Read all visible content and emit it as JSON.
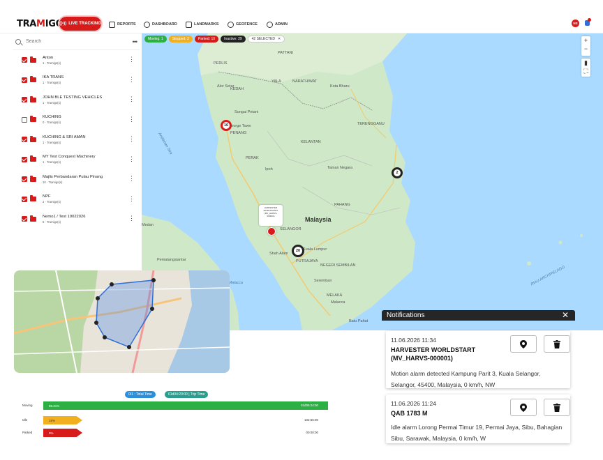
{
  "app": {
    "logo_text": "TRAMIGO",
    "live_tracking_label": "LIVE TRACKING",
    "nav": {
      "reports": "REPORTS",
      "dashboard": "DASHBOARD",
      "landmarks": "LANDMARKS",
      "geofence": "GEOFENCE",
      "admin": "ADMIN"
    },
    "user_initials": "NS",
    "accent_color": "#d71a1a"
  },
  "sidebar": {
    "search_placeholder": "Search",
    "more_label": "•••",
    "groups": [
      {
        "name": "Anton",
        "count": "1 · Tramigo(s)",
        "checked": true
      },
      {
        "name": "IKA TRANS",
        "count": "1 · Tramigo(s)",
        "checked": true
      },
      {
        "name": "JOHN BLE TESTING VEHICLES",
        "count": "1 · Tramigo(s)",
        "checked": true
      },
      {
        "name": "KUCHING",
        "count": "0 · Tramigo(s)",
        "checked": false
      },
      {
        "name": "KUCHING & SRI AMAN",
        "count": "1 · Tramigo(s)",
        "checked": true
      },
      {
        "name": "MY Test Conquest Machinery",
        "count": "1 · Tramigo(s)",
        "checked": true
      },
      {
        "name": "Majlis Perbandaran Pulau Pinang",
        "count": "10 · Tramigo(s)",
        "checked": true
      },
      {
        "name": "NPF",
        "count": "2 · Tramigo(s)",
        "checked": true
      },
      {
        "name": "Nemo1 / Test 19022026",
        "count": "5 · Tramigo(s)",
        "checked": true
      }
    ]
  },
  "map": {
    "chips": {
      "moving": "Moving: 1",
      "stopped": "Stopped: 2",
      "parked": "Parked: 10",
      "inactive": "Inactive: 29",
      "selected": "42 SELECTED",
      "selected_close": "✕"
    },
    "controls": {
      "zoom_in": "+",
      "zoom_out": "−",
      "fullscreen": "⛶"
    },
    "places": {
      "pattani": "PATTANI",
      "perlis": "PERLIS",
      "alor_setar": "Alor Setar",
      "kedah": "KEDAH",
      "yala": "YALA",
      "narathiwat": "NARATHIWAT",
      "kota_bharu": "Kota Bharu",
      "sungai_petani": "Sungai Petani",
      "george_town": "George Town",
      "penang": "PENANG",
      "kelantan": "KELANTAN",
      "terengganu": "TERENGGANU",
      "perak": "PERAK",
      "ipoh": "Ipoh",
      "taman_negara": "Taman Negara",
      "pahang": "PAHANG",
      "malaysia": "Malaysia",
      "selangor": "SELANGOR",
      "kuala_lumpur": "Kuala Lumpur",
      "shah_alam": "Shah Alam",
      "putrajaya": "PUTRAJAYA",
      "negeri_sembilan": "NEGERI SEMBILAN",
      "seremban": "Seremban",
      "melaka": "MELAKA",
      "malacca": "Malacca",
      "batu_pahat": "Batu Pahat",
      "pematangsiantar": "Pematangsiantar",
      "medan": "Medan",
      "strait_of_malacca": "Strait of Malacca",
      "riau_archipelago": "RIAU ARCHIPELAGO",
      "andaman_sea": "Andaman Sea"
    },
    "clusters": {
      "penang": "16",
      "kuantan": "2",
      "kl": "20"
    },
    "vehicle_card": {
      "line1": "HARVESTER",
      "line2": "WORLDSTART",
      "line3": "(MV_HARVS-",
      "line4": "000001)"
    }
  },
  "timeline": {
    "chip_total": "0/1 : Total Time",
    "chip_trip": "01d04:20:00 | Trip Time",
    "rows": [
      {
        "label": "Moving",
        "pct_label": "85.31%",
        "value": "01d05:24:00",
        "fraction": 1.0
      },
      {
        "label": "Idle",
        "pct_label": "15%",
        "value": "102:56:00",
        "fraction": 0.137
      },
      {
        "label": "Parked",
        "pct_label": "0%",
        "value": "00:00:00",
        "fraction": 0.137
      }
    ]
  },
  "notifications": {
    "title": "Notifications",
    "close": "✕",
    "items": [
      {
        "time": "11.06.2026 11:34",
        "title": "HARVESTER WORLDSTART (MV_HARVS-000001)",
        "message": "Motion alarm detected Kampung Parit 3, Kuala Selangor, Selangor, 45400, Malaysia, 0 km/h, NW"
      },
      {
        "time": "11.06.2026 11:24",
        "title": "QAB 1783 M",
        "message": "Idle alarm Lorong Permai Timur 19, Permai Jaya, Sibu, Bahagian Sibu, Sarawak, Malaysia, 0 km/h, W"
      }
    ]
  },
  "colors": {
    "moving": "#2cb044",
    "stopped": "#f2b01e",
    "parked": "#d71a1a",
    "inactive": "#222222",
    "map_water": "#aadaff",
    "map_land": "#cfe8c8"
  }
}
